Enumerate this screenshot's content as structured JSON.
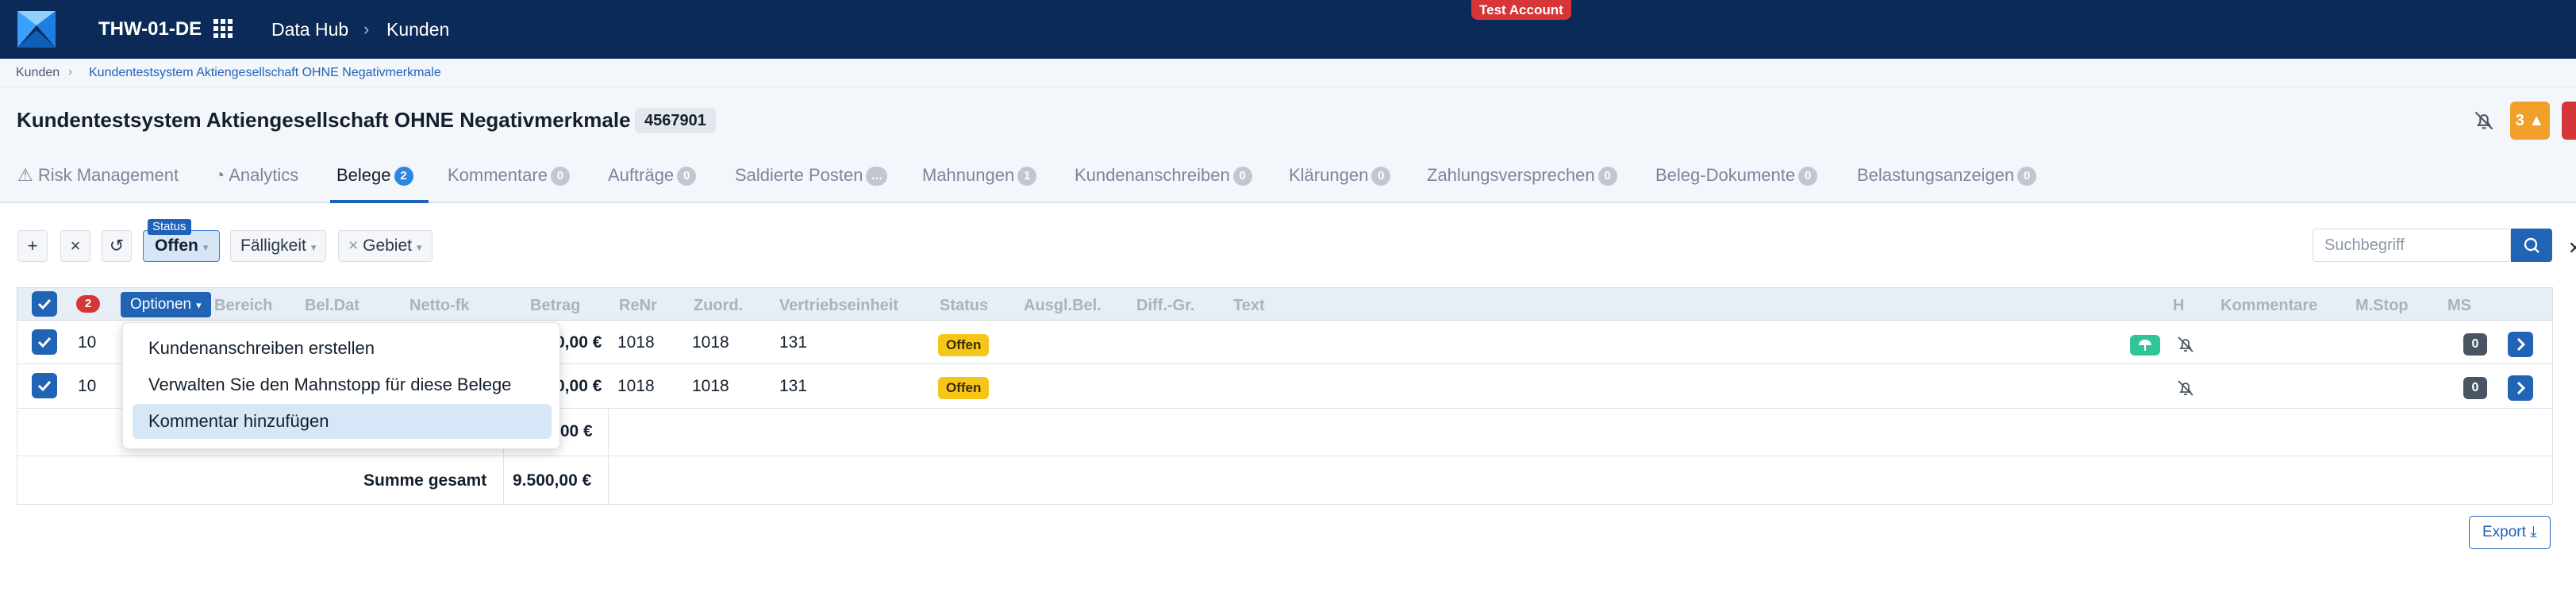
{
  "topbar": {
    "tenant": "THW-01-DE",
    "nav_datahub": "Data Hub",
    "nav_sep": "›",
    "nav_kunden": "Kunden",
    "test_badge": "Test Account",
    "bg_color": "#0c2a57"
  },
  "breadcrumb": {
    "item1": "Kunden",
    "sep": "›",
    "item2": "Kundentestsystem Aktiengesellschaft OHNE Negativmerkmale"
  },
  "header": {
    "title": "Kundentestsystem Aktiengesellschaft OHNE Negativmerkmale",
    "customer_id": "4567901",
    "alert_orange_count": "3"
  },
  "tabs": [
    {
      "label": "Risk Management",
      "count": ""
    },
    {
      "label": "Analytics",
      "count": ""
    },
    {
      "label": "Belege",
      "count": "2"
    },
    {
      "label": "Kommentare",
      "count": "0"
    },
    {
      "label": "Aufträge",
      "count": "0"
    },
    {
      "label": "Saldierte Posten",
      "count": "…"
    },
    {
      "label": "Mahnungen",
      "count": "1"
    },
    {
      "label": "Kundenanschreiben",
      "count": "0"
    },
    {
      "label": "Klärungen",
      "count": "0"
    },
    {
      "label": "Zahlungsversprechen",
      "count": "0"
    },
    {
      "label": "Beleg-Dokumente",
      "count": "0"
    },
    {
      "label": "Belastungsanzeigen",
      "count": "0"
    }
  ],
  "filters": {
    "add_icon": "+",
    "clear_icon": "×",
    "reset_icon": "↺",
    "status_tag": "Status",
    "status_value": "Offen",
    "faelligkeit": "Fälligkeit",
    "gebiet": "Gebiet",
    "search_placeholder": "Suchbegriff",
    "edge_close": "✕"
  },
  "table": {
    "selected_count": "2",
    "options_label": "Optionen",
    "headers": {
      "bereich": "Bereich",
      "beldat": "Bel.Dat",
      "nettofk": "Netto-fk",
      "betrag": "Betrag",
      "renr": "ReNr",
      "zuord": "Zuord.",
      "vertrieb": "Vertriebseinheit",
      "status": "Status",
      "ausglbel": "Ausgl.Bel.",
      "diffgr": "Diff.-Gr.",
      "text": "Text",
      "h": "H",
      "kommentare": "Kommentare",
      "mstop": "M.Stop",
      "ms": "MS"
    },
    "rows": [
      {
        "nr": "10",
        "betrag": "0,00 €",
        "renr": "1018",
        "zuord": "1018",
        "vertrieb": "131",
        "status": "Offen",
        "ms": "0"
      },
      {
        "nr": "10",
        "betrag": "0,00 €",
        "renr": "1018",
        "zuord": "1018",
        "vertrieb": "131",
        "status": "Offen",
        "ms": "0"
      }
    ],
    "subtotal": ",00 €",
    "total_label": "Summe gesamt",
    "total_value": "9.500,00 €"
  },
  "options_menu": [
    "Kundenanschreiben erstellen",
    "Verwalten Sie den Mahnstopp für diese Belege",
    "Kommentar hinzufügen"
  ],
  "export_label": "Export"
}
